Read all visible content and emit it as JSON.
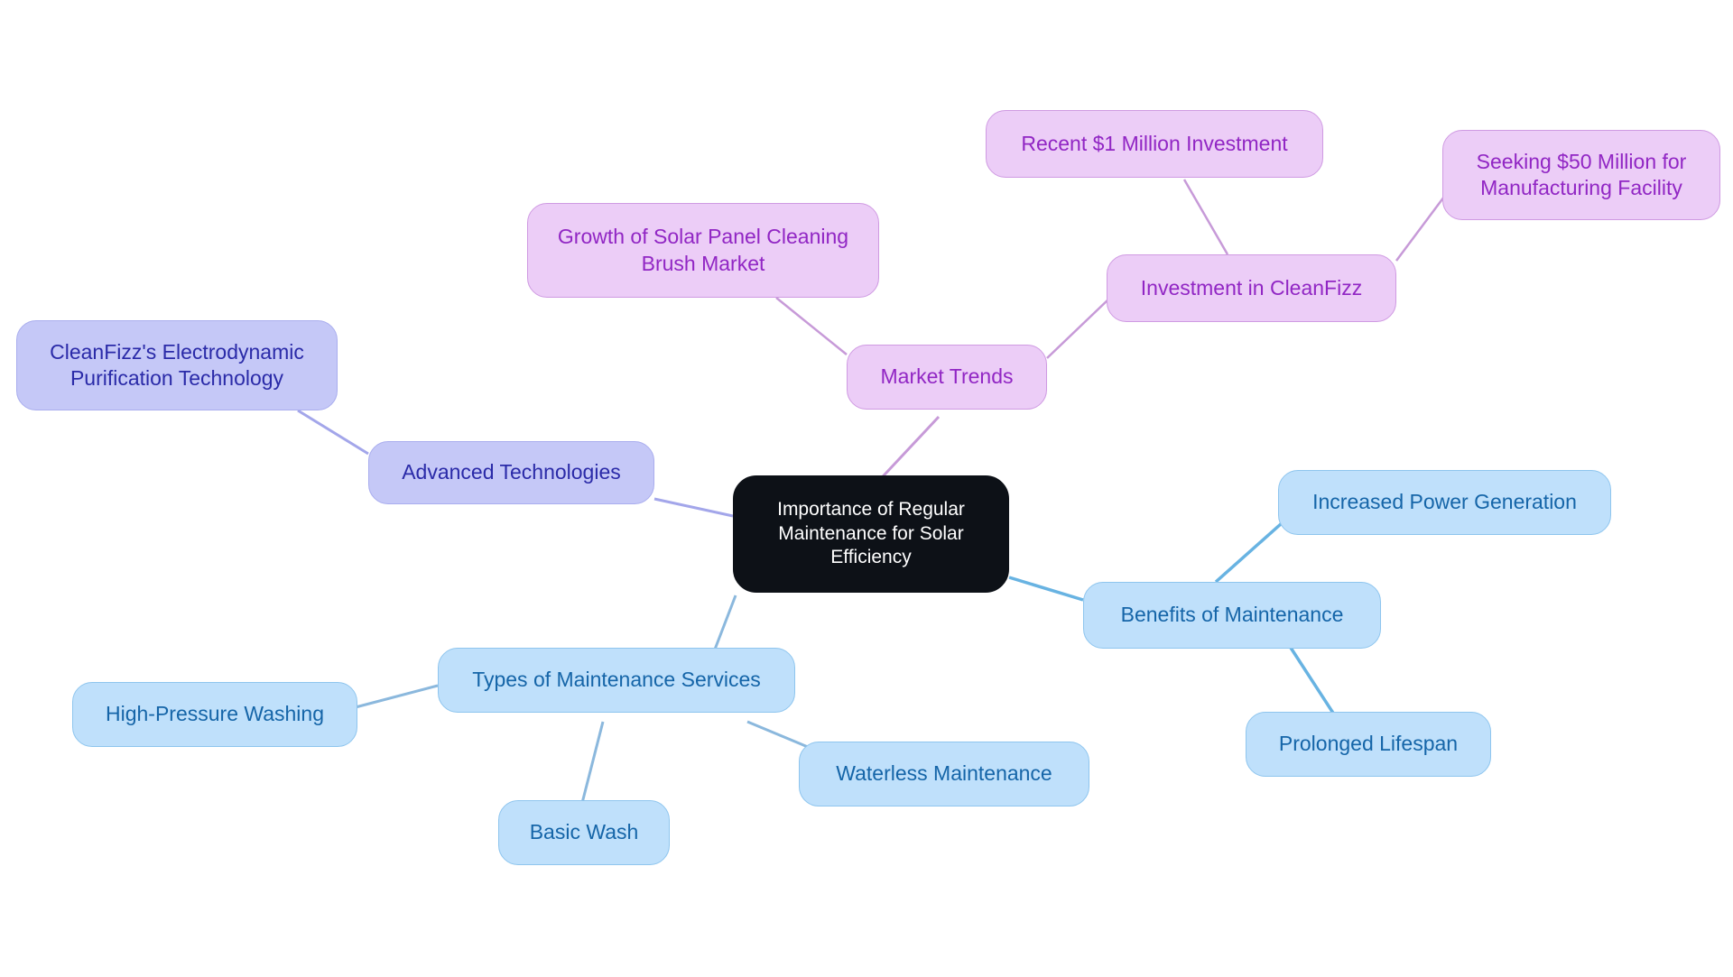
{
  "diagram": {
    "type": "mindmap",
    "title": "Importance of Regular Maintenance for Solar Efficiency",
    "background": "#ffffff",
    "palettes": {
      "root_fill": "#0d1117",
      "root_text": "#ffffff",
      "tech_fill": "#c5c8f7",
      "tech_border": "#a9adee",
      "tech_text": "#2a2aa8",
      "trend_fill": "#eccdf7",
      "trend_border": "#cf9ae2",
      "trend_text": "#9126c4",
      "blue_fill": "#bfe0fb",
      "blue_border": "#8ec5ee",
      "blue_text": "#1565a8"
    },
    "nodes": {
      "root": "Importance of Regular\nMaintenance for Solar\nEfficiency",
      "advanced_technologies": "Advanced Technologies",
      "cleanfizz_tech": "CleanFizz's Electrodynamic\nPurification Technology",
      "market_trends": "Market Trends",
      "brush_market": "Growth of Solar Panel Cleaning\nBrush Market",
      "investment_cleanfizz": "Investment in CleanFizz",
      "recent_investment": "Recent $1 Million Investment",
      "seeking_investment": "Seeking $50 Million for\nManufacturing Facility",
      "benefits": "Benefits of Maintenance",
      "increased_power": "Increased Power Generation",
      "prolonged_lifespan": "Prolonged Lifespan",
      "types_services": "Types of Maintenance Services",
      "high_pressure": "High-Pressure Washing",
      "basic_wash": "Basic Wash",
      "waterless": "Waterless Maintenance"
    },
    "edges": [
      {
        "from": "root",
        "to": "market_trends",
        "color": "#c79ad8"
      },
      {
        "from": "market_trends",
        "to": "brush_market",
        "color": "#c79ad8"
      },
      {
        "from": "market_trends",
        "to": "investment_cleanfizz",
        "color": "#c79ad8"
      },
      {
        "from": "investment_cleanfizz",
        "to": "recent_investment",
        "color": "#c79ad8"
      },
      {
        "from": "investment_cleanfizz",
        "to": "seeking_investment",
        "color": "#c79ad8"
      },
      {
        "from": "root",
        "to": "advanced_technologies",
        "color": "#a3a6ea"
      },
      {
        "from": "advanced_technologies",
        "to": "cleanfizz_tech",
        "color": "#a3a6ea"
      },
      {
        "from": "root",
        "to": "benefits",
        "color": "#68b3e2"
      },
      {
        "from": "benefits",
        "to": "increased_power",
        "color": "#68b3e2"
      },
      {
        "from": "benefits",
        "to": "prolonged_lifespan",
        "color": "#68b3e2"
      },
      {
        "from": "root",
        "to": "types_services",
        "color": "#8bb8dd"
      },
      {
        "from": "types_services",
        "to": "high_pressure",
        "color": "#8bb8dd"
      },
      {
        "from": "types_services",
        "to": "basic_wash",
        "color": "#8bb8dd"
      },
      {
        "from": "types_services",
        "to": "waterless",
        "color": "#8bb8dd"
      }
    ]
  }
}
